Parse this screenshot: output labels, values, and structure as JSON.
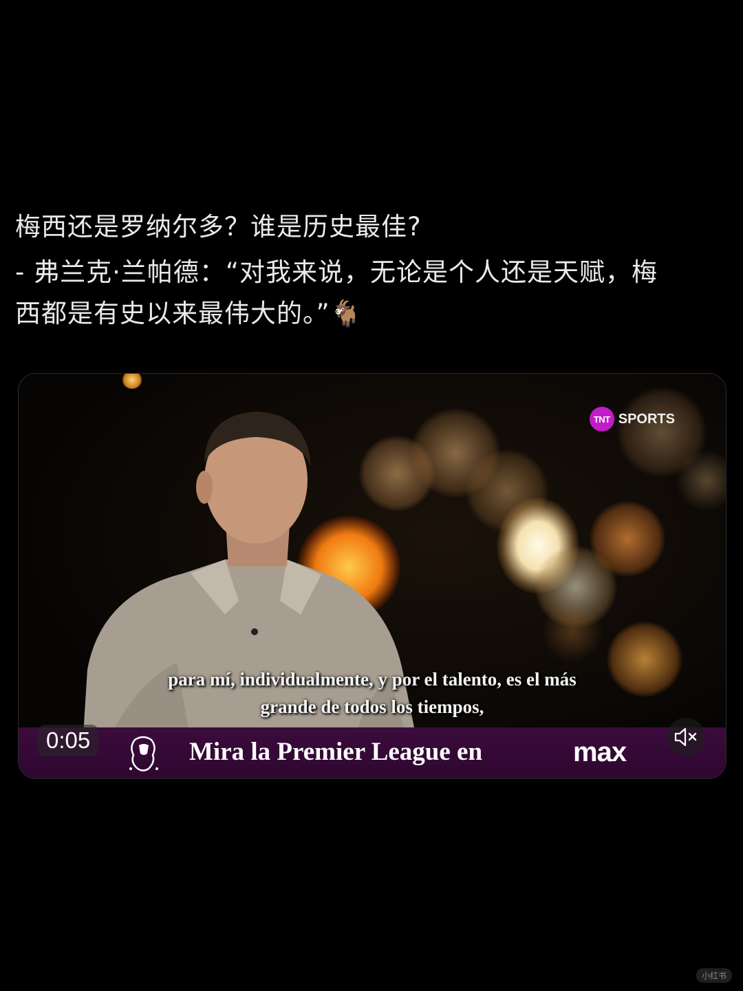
{
  "post": {
    "question": "梅西还是罗纳尔多？谁是历史最佳?",
    "quote_line1": "- 弗兰克·兰帕德：“对我来说，无论是个人还是天赋，梅",
    "quote_line2": "西都是有史以来最伟大的。”🐐"
  },
  "video": {
    "channel_logo_badge": "TNT",
    "channel_logo_word": "SPORTS",
    "subtitle_line1": "para mí, individualmente, y por el talento, es el más",
    "subtitle_line2": "grande de todos los tiempos,",
    "promo_text": "Mira la Premier League en",
    "promo_brand": "max",
    "timestamp": "0:05",
    "promo_color": "#3b0b3c",
    "accent_color": "#c21cc8"
  },
  "watermark": "小红书"
}
